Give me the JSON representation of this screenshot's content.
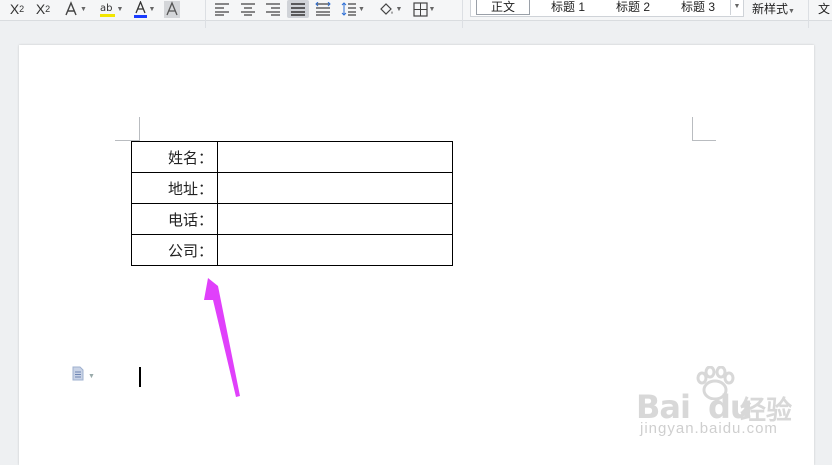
{
  "toolbar": {
    "superscript_label": "X",
    "superscript_mark": "2",
    "subscript_label": "X",
    "subscript_mark": "2"
  },
  "styles": {
    "items": [
      "正文",
      "标题 1",
      "标题 2",
      "标题 3"
    ],
    "new_style_label": "新样式",
    "text_tool_label": "文"
  },
  "table": {
    "rows": [
      {
        "label": "姓名：",
        "value": ""
      },
      {
        "label": "地址：",
        "value": ""
      },
      {
        "label": "电话：",
        "value": ""
      },
      {
        "label": "公司：",
        "value": ""
      }
    ]
  },
  "colors": {
    "highlight": "#f2e600",
    "font_color": "#1a3cff",
    "annotation_arrow": "#e040fb"
  },
  "watermark": {
    "brand": "Bai",
    "brand_tail": "du",
    "product": "经验",
    "url": "jingyan.baidu.com"
  }
}
